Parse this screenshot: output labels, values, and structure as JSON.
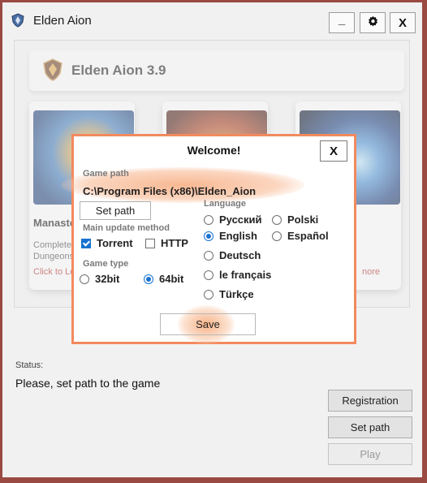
{
  "window": {
    "title": "Elden Aion",
    "controls": {
      "minimize": "_",
      "settings_icon": "gear-icon",
      "close": "X"
    }
  },
  "header": {
    "title": "Elden Aion 3.9"
  },
  "cards": [
    {
      "title": "Manasto",
      "desc": "Complete\nDungeons",
      "link": "Click to Le"
    },
    {
      "title": "",
      "desc": "",
      "link": ""
    },
    {
      "title": "",
      "desc": "",
      "link": "nore"
    }
  ],
  "status": {
    "label": "Status:",
    "text": "Please, set path to the game"
  },
  "buttons": {
    "registration": "Registration",
    "set_path": "Set path",
    "play": "Play"
  },
  "dialog": {
    "title": "Welcome!",
    "close": "X",
    "game_path_label": "Game path",
    "game_path_value": "C:\\Program Files (x86)\\Elden_Aion",
    "set_path": "Set path",
    "update_method_label": "Main update method",
    "update_methods": [
      {
        "label": "Torrent",
        "checked": true
      },
      {
        "label": "HTTP",
        "checked": false
      }
    ],
    "game_type_label": "Game type",
    "game_types": [
      {
        "label": "32bit",
        "selected": false
      },
      {
        "label": "64bit",
        "selected": true
      }
    ],
    "language_label": "Language",
    "languages": [
      {
        "label": "Русский",
        "selected": false
      },
      {
        "label": "Polski",
        "selected": false
      },
      {
        "label": "English",
        "selected": true
      },
      {
        "label": "Español",
        "selected": false
      },
      {
        "label": "Deutsch",
        "selected": false
      },
      {
        "label": "le français",
        "selected": false
      },
      {
        "label": "Türkçe",
        "selected": false
      }
    ],
    "save": "Save"
  },
  "colors": {
    "accent": "#1872d0",
    "dialog_border": "#f28a5e",
    "frame": "#9a4a42",
    "link": "#b22a2a"
  }
}
